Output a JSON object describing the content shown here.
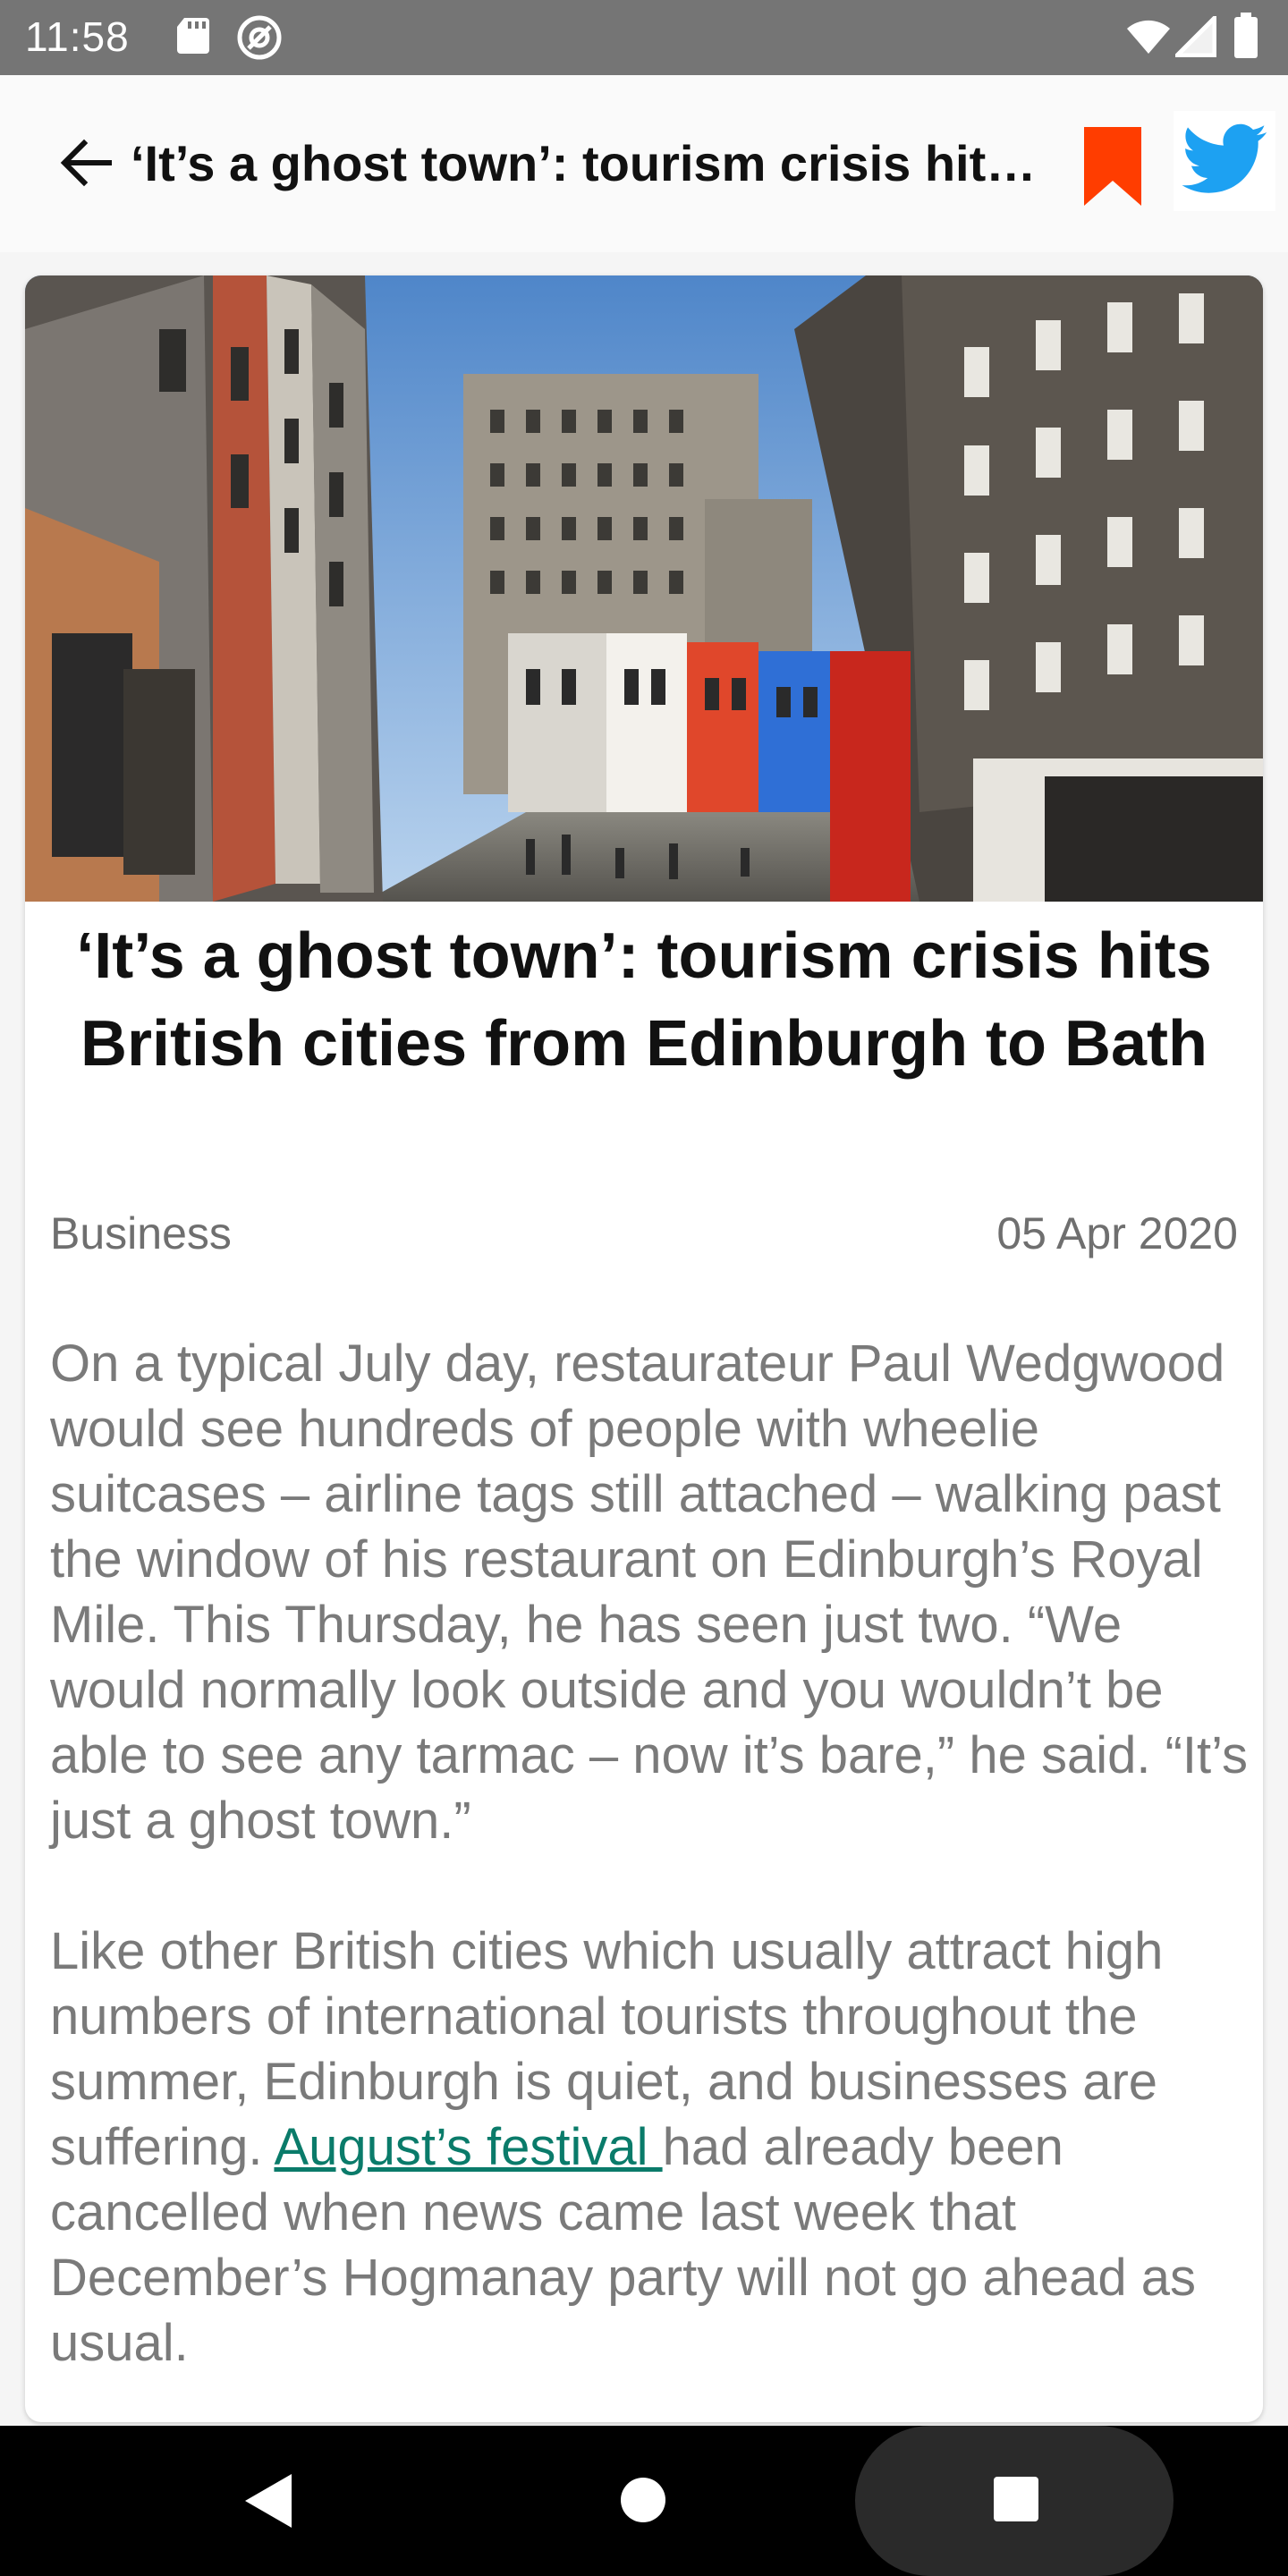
{
  "status_bar": {
    "time": "11:58",
    "icons": [
      "sd-card-icon",
      "at-sign-icon",
      "wifi-icon",
      "signal-icon",
      "battery-icon"
    ]
  },
  "app_bar": {
    "title": "‘It’s a ghost town’: tourism crisis hits British cities from Edinburgh to Bath",
    "back_icon": "arrow-left-icon",
    "bookmark_icon": "bookmark-icon",
    "share_icon": "twitter-icon",
    "colors": {
      "bookmark": "#ff3d00",
      "twitter": "#1da1f2"
    }
  },
  "article": {
    "hero_image": "street-scene-photo",
    "headline": "‘It’s a ghost town’: tourism crisis hits British cities from Edinburgh to Bath",
    "category": "Business",
    "date": "05 Apr 2020",
    "paragraphs": {
      "p1": "On a typical July day, restaurateur Paul Wedgwood would see hundreds of people with wheelie suitcases – airline tags still attached – walking past the window of his restaurant on Edinburgh’s Royal Mile. This Thursday, he has seen just two. “We would normally look outside and you wouldn’t be able to see any tarmac – now it’s bare,” he said. “It’s just a ghost town.”",
      "p2_before": "Like other British cities which usually attract high numbers of international tourists throughout the summer, Edinburgh is quiet, and businesses are suffering. ",
      "p2_link": "August’s festival ",
      "p2_after": "had already been cancelled when news came last week that December’s Hogmanay party will not go ahead as usual."
    },
    "link_color": "#0a7b6a"
  },
  "nav_bar": {
    "icons": [
      "nav-back-icon",
      "nav-home-icon",
      "nav-recents-icon"
    ]
  }
}
